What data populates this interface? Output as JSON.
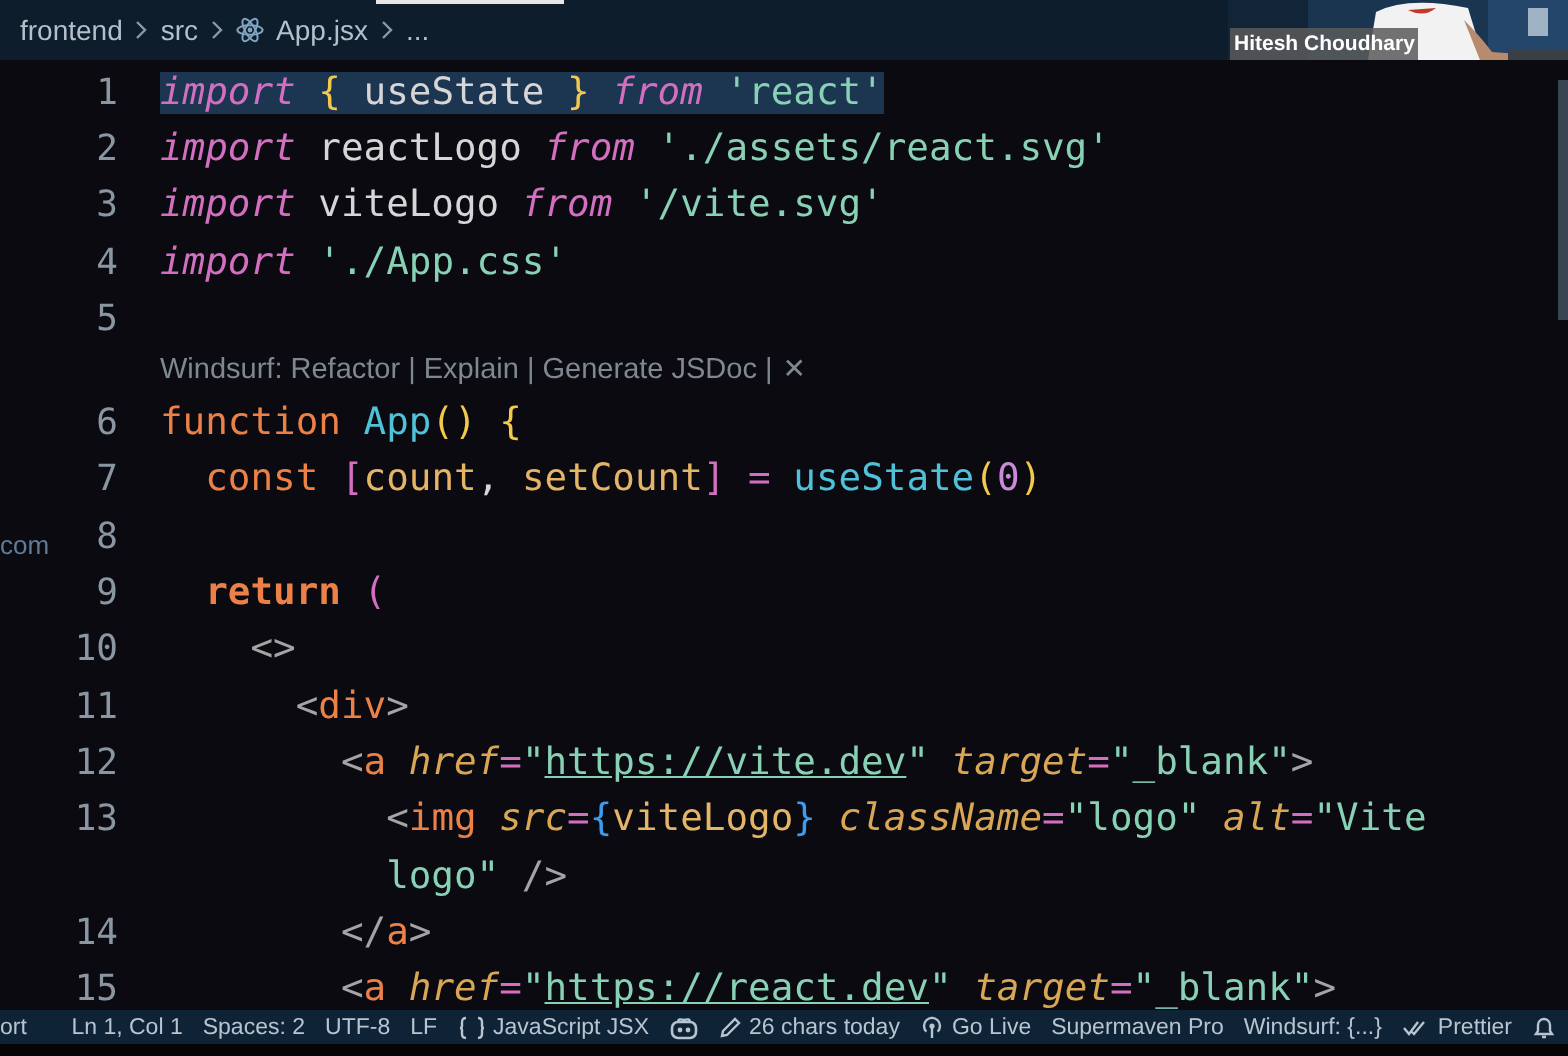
{
  "breadcrumbs": [
    {
      "kind": "folder",
      "text": "frontend"
    },
    {
      "kind": "folder",
      "text": "src"
    },
    {
      "kind": "file",
      "text": "App.jsx"
    },
    {
      "kind": "more",
      "text": "..."
    }
  ],
  "webcam": {
    "kind": "picture",
    "name": "Hitesh Choudhary"
  },
  "side_fragment": "com",
  "editor": {
    "rows": [
      {
        "number": "1",
        "selected": true,
        "tokens": [
          {
            "kind": "kw",
            "text": "import "
          },
          {
            "kind": "brace",
            "text": "{"
          },
          {
            "kind": "plain",
            "text": " useState "
          },
          {
            "kind": "brace",
            "text": "} "
          },
          {
            "kind": "kw",
            "text": "from "
          },
          {
            "kind": "str",
            "text": "'react'"
          }
        ]
      },
      {
        "number": "2",
        "selected": false,
        "tokens": [
          {
            "kind": "kw",
            "text": "import"
          },
          {
            "kind": "plain",
            "text": " reactLogo "
          },
          {
            "kind": "kw",
            "text": "from "
          },
          {
            "kind": "str",
            "text": "'./assets/react.svg'"
          }
        ]
      },
      {
        "number": "3",
        "selected": false,
        "tokens": [
          {
            "kind": "kw",
            "text": "import"
          },
          {
            "kind": "plain",
            "text": " viteLogo "
          },
          {
            "kind": "kw",
            "text": "from "
          },
          {
            "kind": "str",
            "text": "'/vite.svg'"
          }
        ]
      },
      {
        "number": "4",
        "selected": false,
        "tokens": [
          {
            "kind": "kw",
            "text": "import "
          },
          {
            "kind": "str",
            "text": "'./App.css'"
          }
        ]
      },
      {
        "number": "5",
        "selected": false
      },
      {
        "kind": "codelens",
        "text": "Windsurf: Refactor | Explain | Generate JSDoc |",
        "close": "✕"
      },
      {
        "number": "6",
        "selected": false,
        "tokens": [
          {
            "kind": "decl",
            "text": "function "
          },
          {
            "kind": "fn",
            "text": "App"
          },
          {
            "kind": "brace",
            "text": "() {"
          }
        ]
      },
      {
        "number": "7",
        "selected": false,
        "tokens": [
          {
            "kind": "decl",
            "text": "  const "
          },
          {
            "kind": "punc",
            "text": "["
          },
          {
            "kind": "var",
            "text": "count"
          },
          {
            "kind": "plain",
            "text": ", "
          },
          {
            "kind": "var",
            "text": "setCount"
          },
          {
            "kind": "punc",
            "text": "] = "
          },
          {
            "kind": "fn",
            "text": "useState"
          },
          {
            "kind": "brace",
            "text": "("
          },
          {
            "kind": "num",
            "text": "0"
          },
          {
            "kind": "brace",
            "text": ")"
          }
        ]
      },
      {
        "number": "8",
        "selected": false
      },
      {
        "number": "9",
        "selected": false,
        "tokens": [
          {
            "kind": "ret",
            "text": "  return "
          },
          {
            "kind": "punc",
            "text": "("
          }
        ]
      },
      {
        "number": "10",
        "selected": false,
        "tokens": [
          {
            "kind": "gray",
            "text": "    <>"
          }
        ]
      },
      {
        "number": "11",
        "selected": false,
        "tokens": [
          {
            "kind": "gray",
            "text": "      <"
          },
          {
            "kind": "tag",
            "text": "div"
          },
          {
            "kind": "gray",
            "text": ">"
          }
        ]
      },
      {
        "number": "12",
        "selected": false,
        "tokens": [
          {
            "kind": "gray",
            "text": "        <"
          },
          {
            "kind": "tag",
            "text": "a "
          },
          {
            "kind": "attr",
            "text": "href"
          },
          {
            "kind": "punc",
            "text": "="
          },
          {
            "kind": "str",
            "text": "\""
          },
          {
            "kind": "url",
            "text": "https://vite.dev"
          },
          {
            "kind": "str",
            "text": "\" "
          },
          {
            "kind": "attr",
            "text": "target"
          },
          {
            "kind": "punc",
            "text": "="
          },
          {
            "kind": "str",
            "text": "\"_blank\""
          },
          {
            "kind": "gray",
            "text": ">"
          }
        ]
      },
      {
        "number": "13",
        "selected": false,
        "tokens": [
          {
            "kind": "gray",
            "text": "          <"
          },
          {
            "kind": "tag",
            "text": "img "
          },
          {
            "kind": "attr",
            "text": "src"
          },
          {
            "kind": "punc",
            "text": "="
          },
          {
            "kind": "jsx",
            "text": "{"
          },
          {
            "kind": "var",
            "text": "viteLogo"
          },
          {
            "kind": "jsx",
            "text": "} "
          },
          {
            "kind": "attr",
            "text": "className"
          },
          {
            "kind": "punc",
            "text": "="
          },
          {
            "kind": "str",
            "text": "\"logo\" "
          },
          {
            "kind": "attr",
            "text": "alt"
          },
          {
            "kind": "punc",
            "text": "="
          },
          {
            "kind": "str",
            "text": "\"Vite"
          }
        ]
      },
      {
        "selected": false,
        "tokens": [
          {
            "kind": "str",
            "text": "          logo\" "
          },
          {
            "kind": "gray",
            "text": "/>"
          }
        ]
      },
      {
        "number": "14",
        "selected": false,
        "tokens": [
          {
            "kind": "gray",
            "text": "        </"
          },
          {
            "kind": "tag",
            "text": "a"
          },
          {
            "kind": "gray",
            "text": ">"
          }
        ]
      },
      {
        "number": "15",
        "selected": false,
        "tokens": [
          {
            "kind": "gray",
            "text": "        <"
          },
          {
            "kind": "tag",
            "text": "a "
          },
          {
            "kind": "attr",
            "text": "href"
          },
          {
            "kind": "punc",
            "text": "="
          },
          {
            "kind": "str",
            "text": "\""
          },
          {
            "kind": "url",
            "text": "https://react.dev"
          },
          {
            "kind": "str",
            "text": "\" "
          },
          {
            "kind": "attr",
            "text": "target"
          },
          {
            "kind": "punc",
            "text": "="
          },
          {
            "kind": "str",
            "text": "\"_blank\""
          },
          {
            "kind": "gray",
            "text": ">"
          }
        ]
      }
    ]
  },
  "status_bar": {
    "left": "ort",
    "items": [
      {
        "kind": "text",
        "text": "Ln 1, Col 1"
      },
      {
        "kind": "text",
        "text": "Spaces: 2"
      },
      {
        "kind": "text",
        "text": "UTF-8"
      },
      {
        "kind": "text",
        "text": "LF"
      },
      {
        "kind": "braces",
        "text": "JavaScript JSX"
      },
      {
        "kind": "robot"
      },
      {
        "kind": "pencil",
        "text": "26 chars today"
      },
      {
        "kind": "broadcast",
        "text": "Go Live"
      },
      {
        "kind": "text",
        "text": "Supermaven Pro"
      },
      {
        "kind": "text",
        "text": "Windsurf: {...}"
      },
      {
        "kind": "checks",
        "text": "Prettier"
      },
      {
        "kind": "bell"
      }
    ]
  }
}
